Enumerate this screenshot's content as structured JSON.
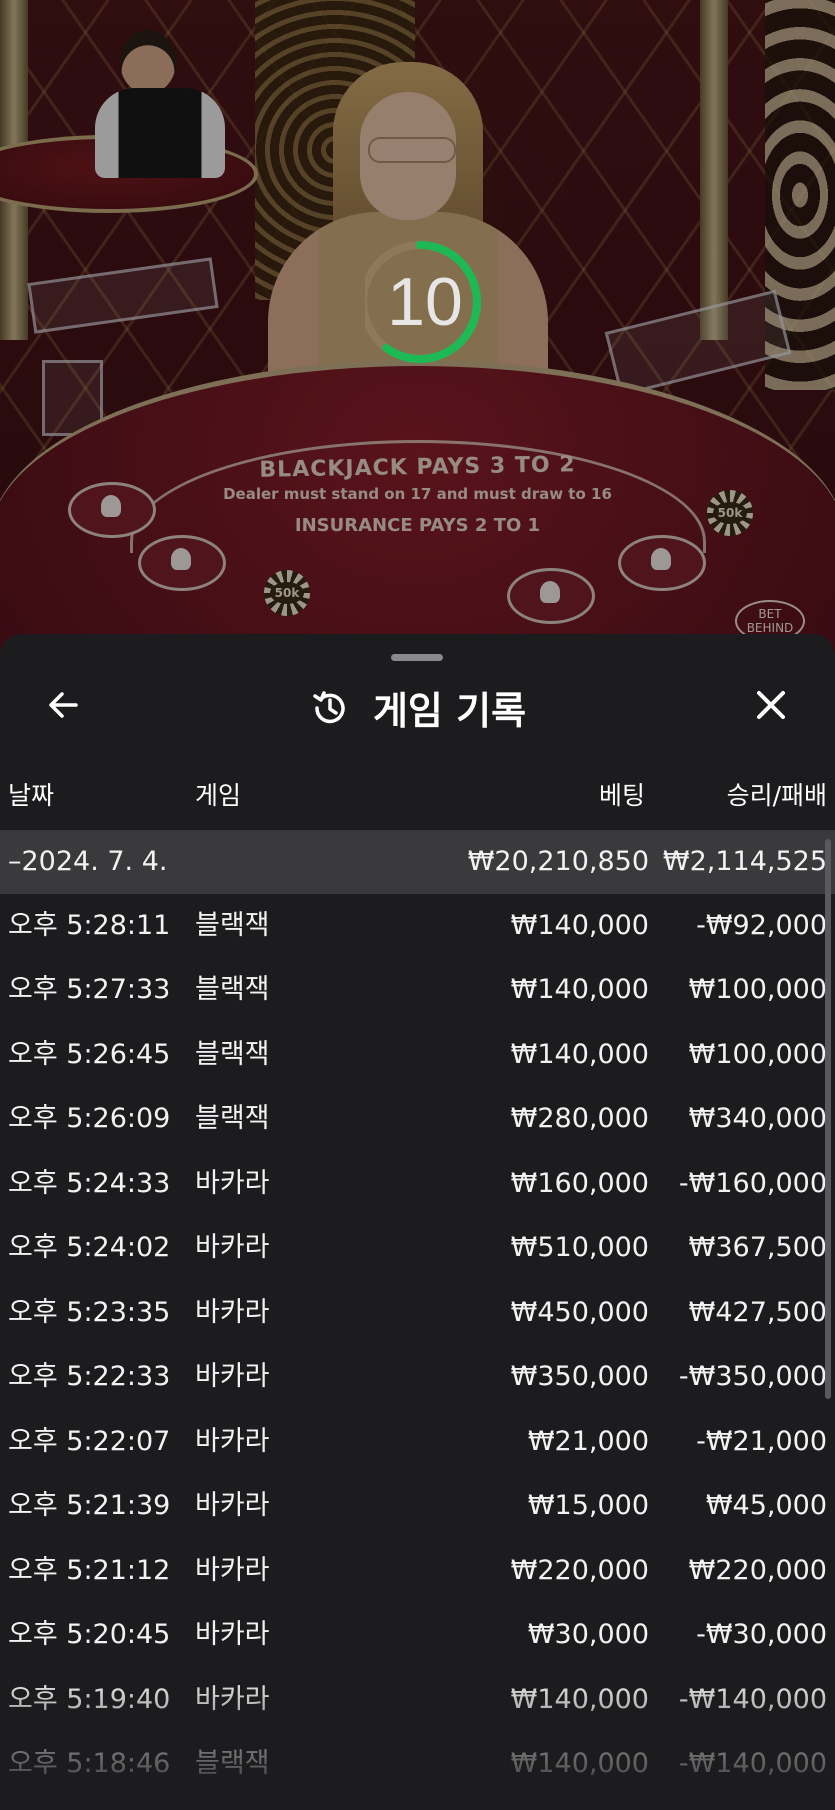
{
  "video": {
    "felt_line1": "BLACKJACK PAYS 3 TO 2",
    "felt_line2": "Dealer must stand on 17 and must draw to 16",
    "felt_line3": "INSURANCE PAYS 2 TO 1",
    "chip_label": "50k",
    "bet_behind_label_line1": "BET",
    "bet_behind_label_line2": "BEHIND"
  },
  "timer": {
    "value": "10",
    "remaining_fraction": 0.6,
    "color": "#1db954"
  },
  "sheet": {
    "title": "게임 기록",
    "back_icon": "arrow-left-icon",
    "history_icon": "history-clock-icon",
    "close_icon": "close-icon",
    "columns": {
      "date": "날짜",
      "game": "게임",
      "bet": "베팅",
      "result": "승리/패배"
    },
    "date_group": {
      "label": "–2024. 7. 4.",
      "bet_total": "₩20,210,850",
      "result_total": "₩2,114,525"
    },
    "rows": [
      {
        "time": "오후 5:28:11",
        "game": "블랙잭",
        "bet": "₩140,000",
        "result": "-₩92,000"
      },
      {
        "time": "오후 5:27:33",
        "game": "블랙잭",
        "bet": "₩140,000",
        "result": "₩100,000"
      },
      {
        "time": "오후 5:26:45",
        "game": "블랙잭",
        "bet": "₩140,000",
        "result": "₩100,000"
      },
      {
        "time": "오후 5:26:09",
        "game": "블랙잭",
        "bet": "₩280,000",
        "result": "₩340,000"
      },
      {
        "time": "오후 5:24:33",
        "game": "바카라",
        "bet": "₩160,000",
        "result": "-₩160,000"
      },
      {
        "time": "오후 5:24:02",
        "game": "바카라",
        "bet": "₩510,000",
        "result": "₩367,500"
      },
      {
        "time": "오후 5:23:35",
        "game": "바카라",
        "bet": "₩450,000",
        "result": "₩427,500"
      },
      {
        "time": "오후 5:22:33",
        "game": "바카라",
        "bet": "₩350,000",
        "result": "-₩350,000"
      },
      {
        "time": "오후 5:22:07",
        "game": "바카라",
        "bet": "₩21,000",
        "result": "-₩21,000"
      },
      {
        "time": "오후 5:21:39",
        "game": "바카라",
        "bet": "₩15,000",
        "result": "₩45,000"
      },
      {
        "time": "오후 5:21:12",
        "game": "바카라",
        "bet": "₩220,000",
        "result": "₩220,000"
      },
      {
        "time": "오후 5:20:45",
        "game": "바카라",
        "bet": "₩30,000",
        "result": "-₩30,000"
      },
      {
        "time": "오후 5:19:40",
        "game": "바카라",
        "bet": "₩140,000",
        "result": "-₩140,000"
      },
      {
        "time": "오후 5:18:46",
        "game": "블랙잭",
        "bet": "₩140,000",
        "result": "-₩140,000"
      }
    ]
  }
}
